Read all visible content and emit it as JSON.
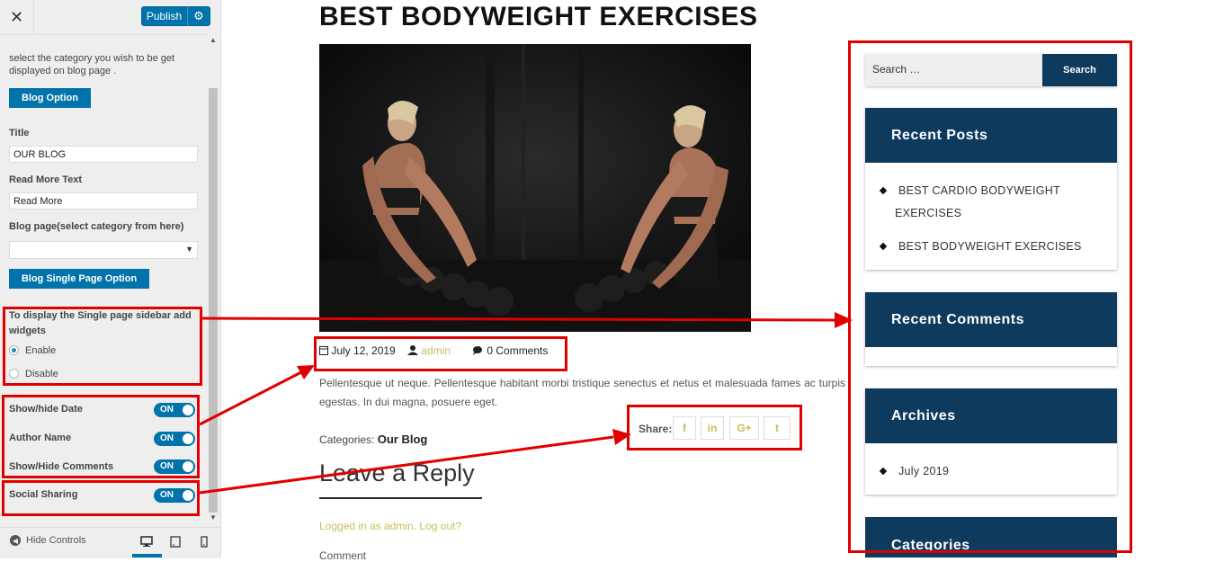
{
  "panel": {
    "close_label": "✕",
    "publish_label": "Publish",
    "gear_label": "⚙",
    "intro_text_1": "select the category you wish to be get",
    "intro_text_2": "displayed on blog page .",
    "blog_option_label": "Blog Option",
    "title_label": "Title",
    "title_value": "OUR BLOG",
    "read_more_label": "Read More Text",
    "read_more_value": "Read More",
    "blog_page_label": "Blog page(select category from here)",
    "blog_page_value": "",
    "single_option_label": "Blog Single Page Option",
    "sidebar_widgets_label_1": "To display the Single page sidebar add",
    "sidebar_widgets_label_2": "widgets",
    "enable_label": "Enable",
    "disable_label": "Disable",
    "sidebar_selected": "Enable",
    "toggles": [
      {
        "label": "Show/hide Date",
        "state": "ON"
      },
      {
        "label": "Author Name",
        "state": "ON"
      },
      {
        "label": "Show/Hide Comments",
        "state": "ON"
      },
      {
        "label": "Social Sharing",
        "state": "ON"
      }
    ],
    "hide_controls_label": "Hide Controls"
  },
  "post": {
    "title": "BEST BODYWEIGHT EXERCISES",
    "date": "July 12, 2019",
    "author": "admin",
    "comments": "0 Comments",
    "excerpt": "Pellentesque ut neque. Pellentesque habitant morbi tristique senectus et netus et malesuada fames ac turpis egestas. In dui magna, posuere eget.",
    "share_label": "Share:",
    "share_buttons": [
      "f",
      "in",
      "G+",
      "t"
    ],
    "categories_label": "Categories:",
    "category": "Our Blog",
    "reply_title": "Leave a Reply",
    "logged_in": "Logged in as admin. Log out?",
    "comment_label": "Comment"
  },
  "sidebar": {
    "search_placeholder": "Search …",
    "search_button": "Search",
    "recent_posts_title": "Recent Posts",
    "recent_posts": [
      "BEST CARDIO BODYWEIGHT",
      "EXERCISES",
      "BEST BODYWEIGHT EXERCISES"
    ],
    "recent_comments_title": "Recent Comments",
    "archives_title": "Archives",
    "archives": [
      "July 2019"
    ],
    "categories_title": "Categories"
  },
  "colors": {
    "accent": "#0073aa",
    "widget_header": "#0e3a5e",
    "link": "#c7c05a",
    "annotation": "#e00000"
  }
}
